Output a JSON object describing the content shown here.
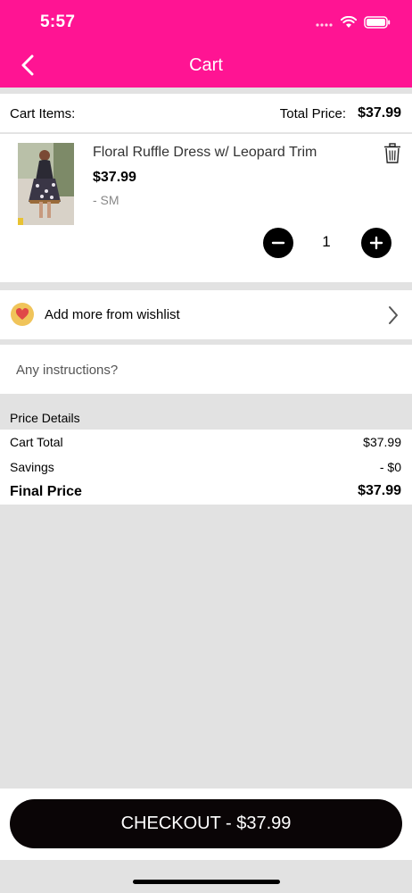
{
  "status_bar": {
    "time": "5:57"
  },
  "header": {
    "title": "Cart"
  },
  "summary": {
    "cart_items_label": "Cart Items:",
    "total_price_label": "Total Price:",
    "total_price_value": "$37.99"
  },
  "item": {
    "name": "Floral Ruffle Dress w/ Leopard Trim",
    "price": "$37.99",
    "size": "- SM",
    "quantity": "1"
  },
  "wishlist": {
    "label": "Add more from wishlist"
  },
  "instructions": {
    "placeholder": "Any instructions?"
  },
  "price_details": {
    "title": "Price Details",
    "cart_total_label": "Cart Total",
    "cart_total_value": "$37.99",
    "savings_label": "Savings",
    "savings_value": "- $0",
    "final_price_label": "Final Price",
    "final_price_value": "$37.99"
  },
  "checkout": {
    "label": "CHECKOUT - $37.99"
  },
  "colors": {
    "brand": "#ff1493",
    "button": "#0a0506",
    "wishlist_icon_bg": "#f0c45a",
    "heart": "#e04848"
  }
}
